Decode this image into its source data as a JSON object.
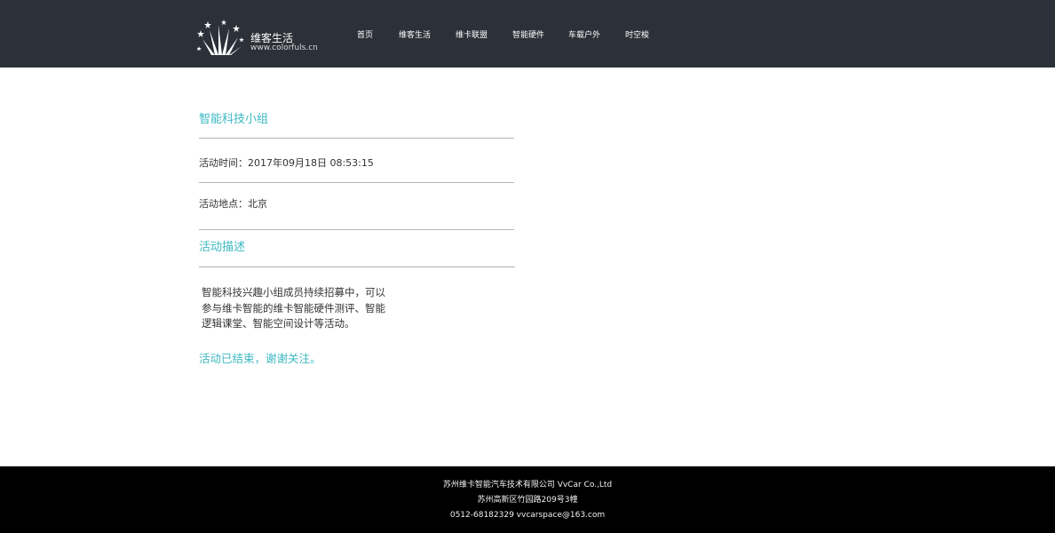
{
  "header": {
    "logo_name": "维客生活",
    "logo_url": "www.colorfuls.cn",
    "nav": [
      {
        "label": "首页"
      },
      {
        "label": "维客生活"
      },
      {
        "label": "维卡联盟"
      },
      {
        "label": "智能硬件"
      },
      {
        "label": "车载户外"
      },
      {
        "label": "时空梭"
      }
    ]
  },
  "event": {
    "title": "智能科技小组",
    "time": "活动时间：2017年09月18日 08:53:15",
    "location": "活动地点：北京",
    "description_heading": "活动描述",
    "description_lines": [
      "智能科技兴趣小组成员持续招募中，可以",
      "参与维卡智能的维卡智能硬件测评、智能",
      "逻辑课堂、智能空间设计等活动。"
    ],
    "status": "活动已结束，谢谢关注。"
  },
  "footer": {
    "company": "苏州维卡智能汽车技术有限公司 VvCar Co.,Ltd",
    "address": "苏州高新区竹园路209号3幢",
    "contact": "0512-68182329    vvcarspace@163.com"
  },
  "colors": {
    "header_bg": "#2c3038",
    "accent": "#3cb8c4",
    "footer_bg": "#000000"
  }
}
